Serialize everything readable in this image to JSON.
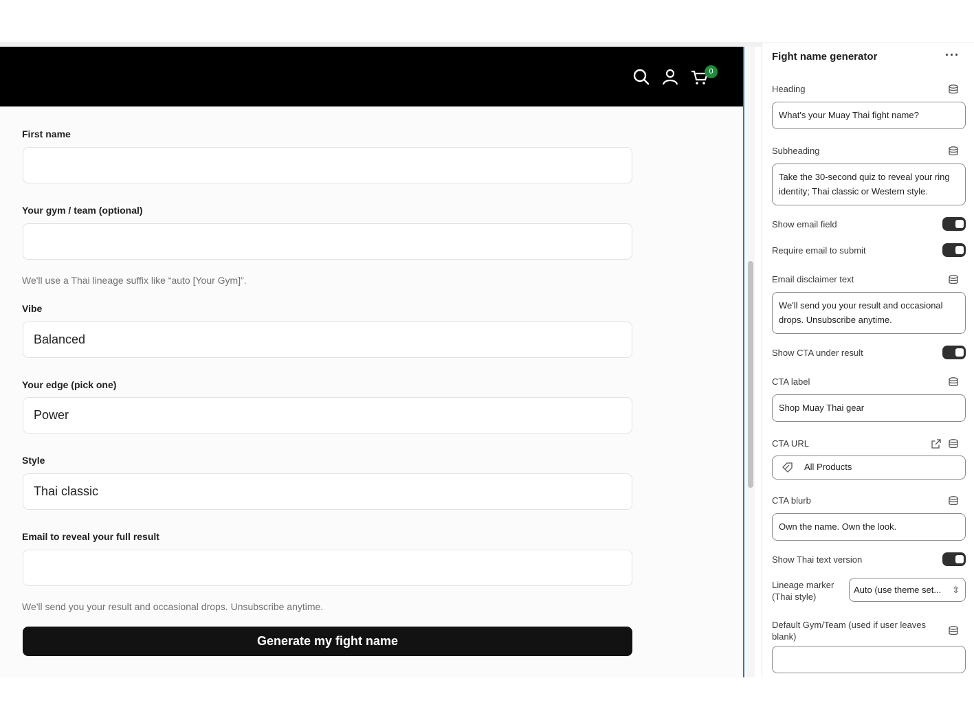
{
  "header": {
    "cart_count": "0"
  },
  "form": {
    "first_name_label": "First name",
    "gym_label": "Your gym / team (optional)",
    "gym_help": "We'll use a Thai lineage suffix like “auto [Your Gym]”.",
    "vibe_label": "Vibe",
    "vibe_value": "Balanced",
    "edge_label": "Your edge (pick one)",
    "edge_value": "Power",
    "style_label": "Style",
    "style_value": "Thai classic",
    "email_label": "Email to reveal your full result",
    "email_help": "We'll send you your result and occasional drops. Unsubscribe anytime.",
    "submit_label": "Generate my fight name"
  },
  "panel": {
    "title": "Fight name generator",
    "more": "···",
    "heading_label": "Heading",
    "heading_value": "What's your Muay Thai fight name?",
    "subheading_label": "Subheading",
    "subheading_value": "Take the 30-second quiz to reveal your ring identity; Thai classic or Western style.",
    "show_email_label": "Show email field",
    "require_email_label": "Require email to submit",
    "disclaimer_label": "Email disclaimer text",
    "disclaimer_value": "We'll send you your result and occasional drops. Unsubscribe anytime.",
    "show_cta_label": "Show CTA under result",
    "cta_label_label": "CTA label",
    "cta_label_value": "Shop Muay Thai gear",
    "cta_url_label": "CTA URL",
    "cta_url_value": "All Products",
    "cta_blurb_label": "CTA blurb",
    "cta_blurb_value": "Own the name. Own the look.",
    "show_thai_label": "Show Thai text version",
    "lineage_label": "Lineage marker (Thai style)",
    "lineage_value": "Auto (use theme set...",
    "default_gym_label": "Default Gym/Team (used if user leaves blank)"
  },
  "colors": {
    "accent_blue": "#2f6fdc",
    "badge_green": "#1c8c3c",
    "button_black": "#121212"
  }
}
